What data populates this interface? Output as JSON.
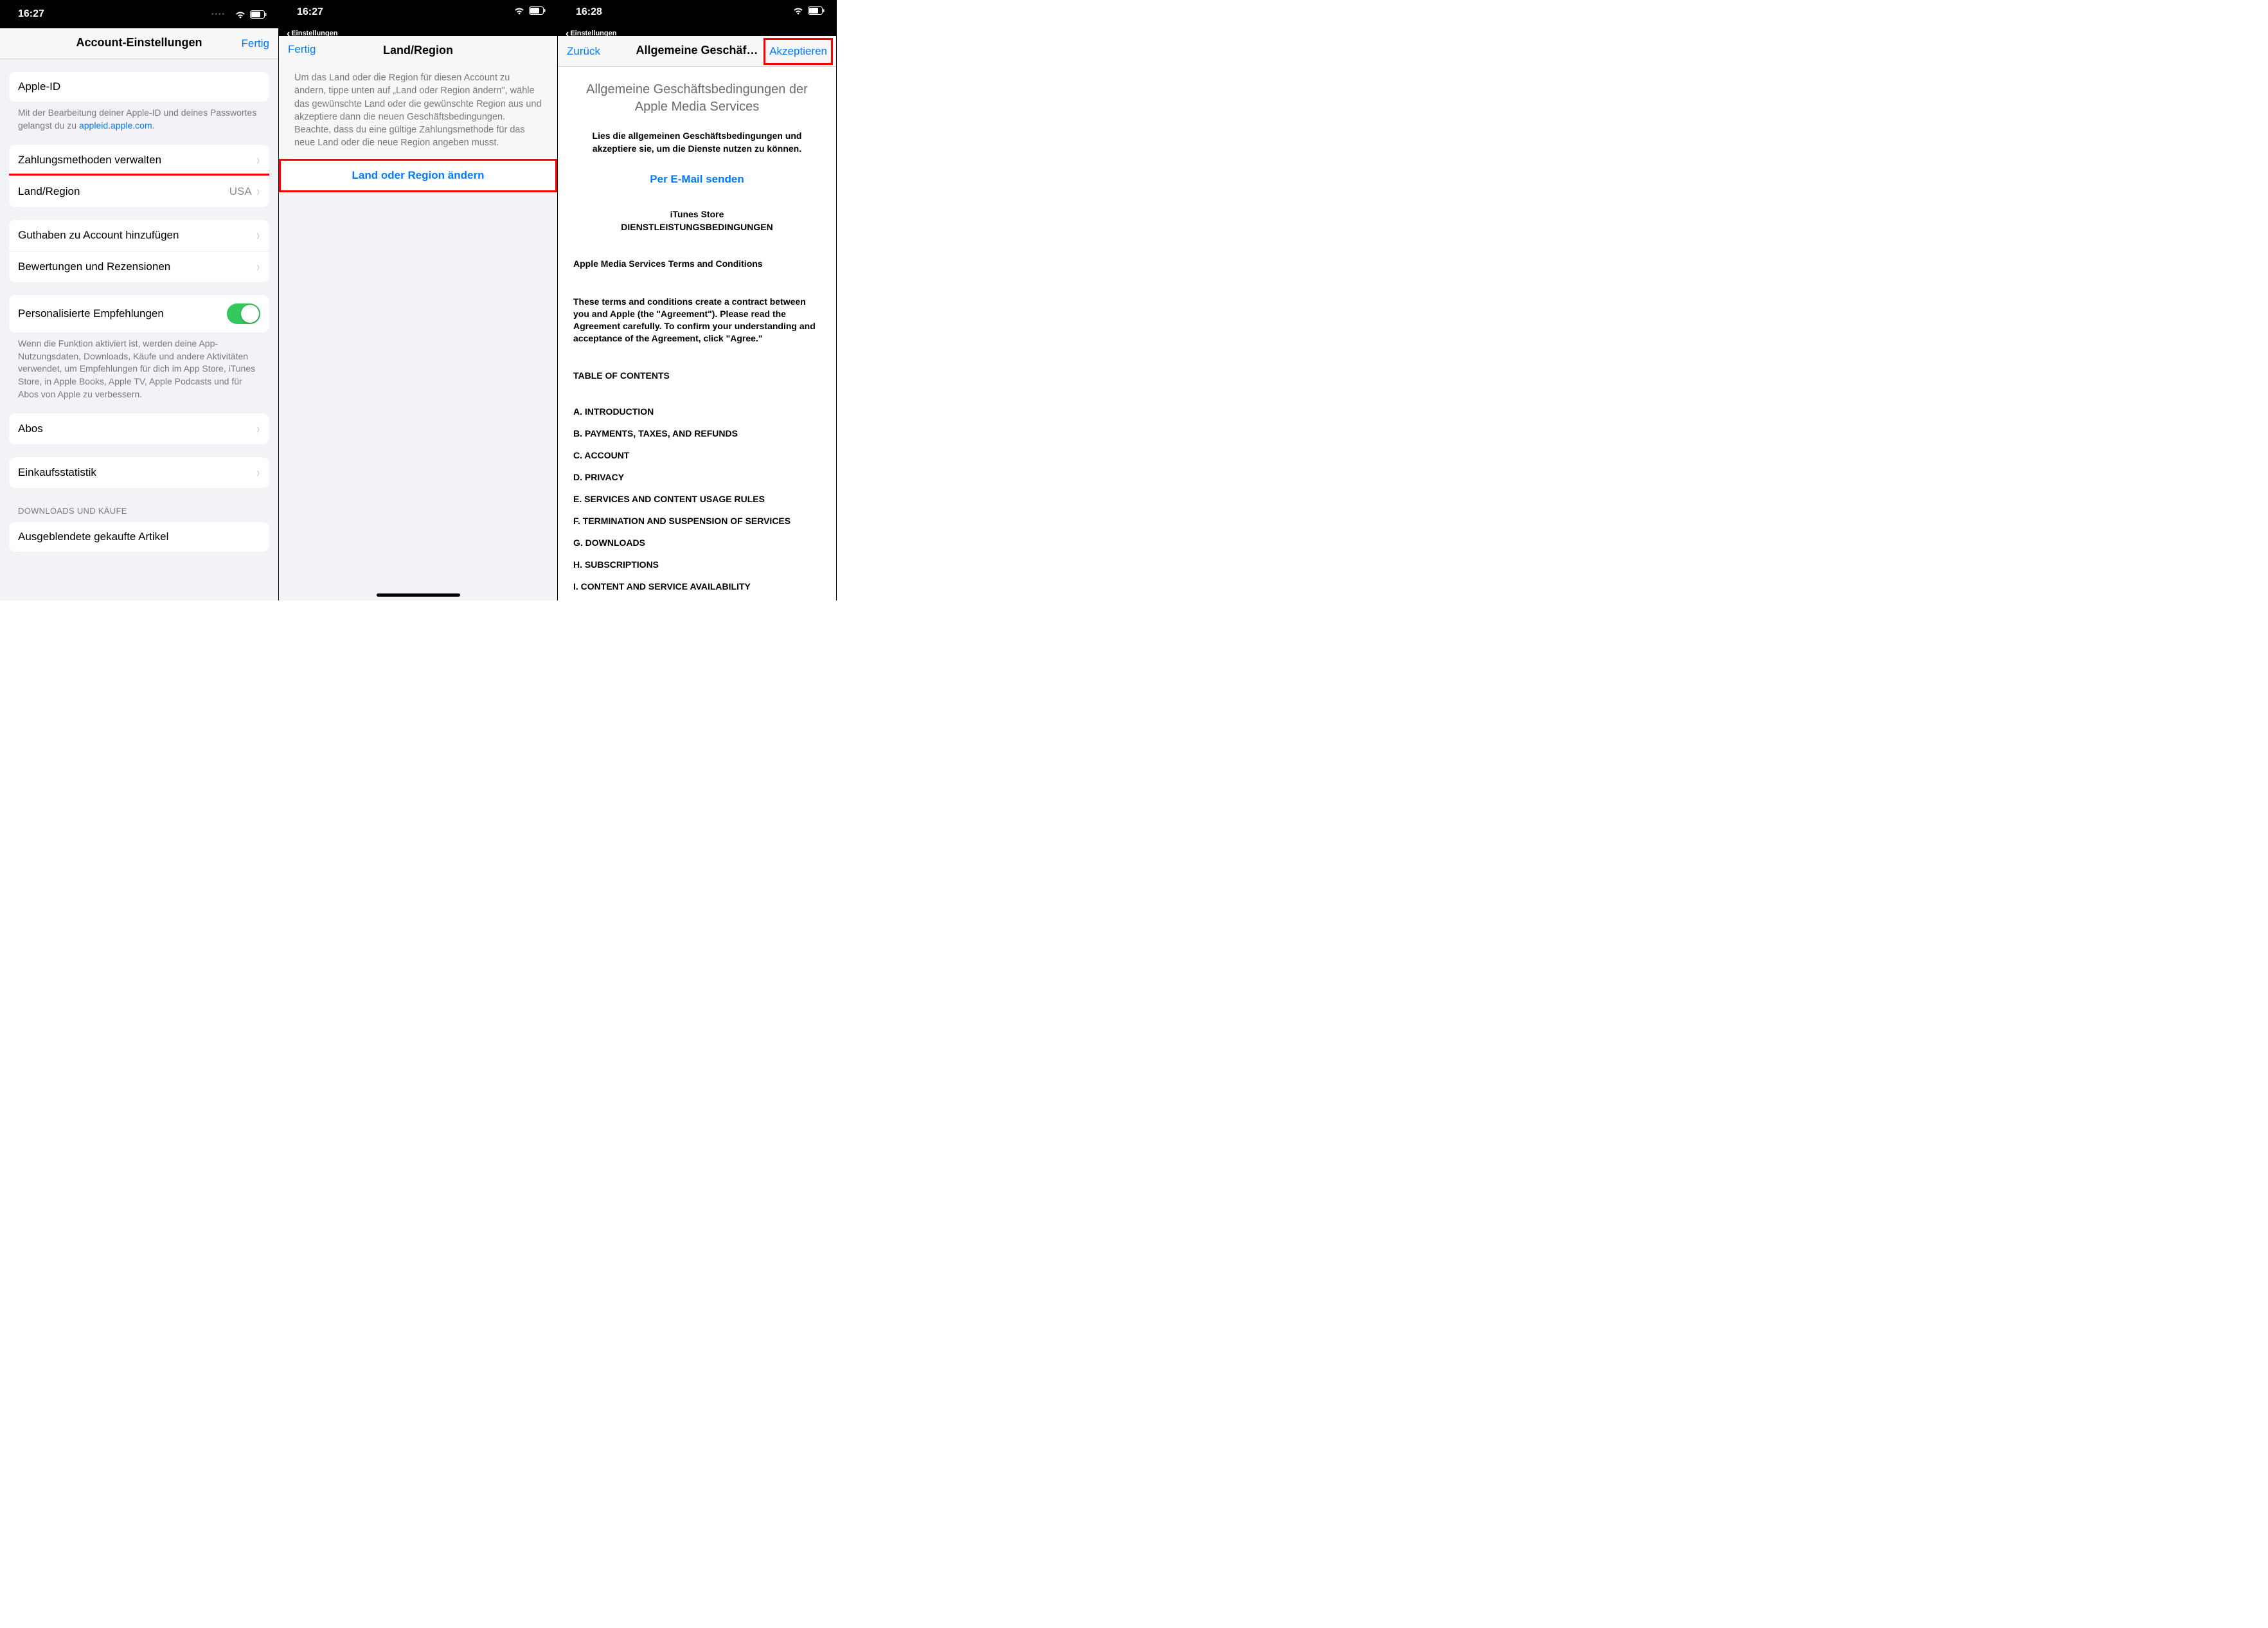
{
  "screen1": {
    "time": "16:27",
    "title": "Account-Einstellungen",
    "done": "Fertig",
    "appleIdLabel": "Apple-ID",
    "appleIdFooterPrefix": "Mit der Bearbeitung deiner Apple-ID und deines Passwortes gelangst du zu ",
    "appleIdFooterLink": "appleid.apple.com",
    "appleIdFooterSuffix": ".",
    "payment": "Zahlungsmethoden verwalten",
    "countryLabel": "Land/Region",
    "countryValue": "USA",
    "addFunds": "Guthaben zu Account hinzufügen",
    "ratings": "Bewertungen und Rezensionen",
    "personalized": "Personalisierte Empfehlungen",
    "personalizedFooter": "Wenn die Funktion aktiviert ist, werden deine App-Nutzungsdaten, Downloads, Käufe und andere Aktivitäten verwendet, um Empfehlungen für dich im App Store, iTunes Store, in Apple Books, Apple TV, Apple Podcasts und für Abos von Apple zu verbessern.",
    "subs": "Abos",
    "purchaseStats": "Einkaufsstatistik",
    "downloadsHeader": "DOWNLOADS UND KÄUFE",
    "hiddenPurchases": "Ausgeblendete gekaufte Artikel"
  },
  "screen2": {
    "time": "16:27",
    "back": "Einstellungen",
    "done": "Fertig",
    "title": "Land/Region",
    "instructions": "Um das Land oder die Region für diesen Account zu ändern, tippe unten auf „Land oder Region ändern\", wähle das gewünschte Land oder die gewünschte Region aus und akzeptiere dann die neuen Geschäftsbedingungen. Beachte, dass du eine gültige Zahlungsmethode für das neue Land oder die neue Region angeben musst.",
    "changeButton": "Land oder Region ändern"
  },
  "screen3": {
    "time": "16:28",
    "backSmall": "Einstellungen",
    "back": "Zurück",
    "title": "Allgemeine Geschäf…",
    "accept": "Akzeptieren",
    "bigTitle": "Allgemeine Geschäftsbedingungen der Apple Media Services",
    "subtitle": "Lies die allgemeinen Geschäftsbedingungen und akzeptiere sie, um die Dienste nutzen zu können.",
    "emailLink": "Per E-Mail senden",
    "h1": "iTunes Store",
    "h2": "DIENSTLEISTUNGSBEDINGUNGEN",
    "para1": "Apple Media Services Terms and Conditions",
    "para2": "These terms and conditions create a contract between you and Apple (the \"Agreement\"). Please read the Agreement carefully. To confirm your understanding and acceptance of the Agreement, click \"Agree.\"",
    "tocHead": "TABLE OF CONTENTS",
    "toc": [
      "A. INTRODUCTION",
      "B. PAYMENTS, TAXES, AND REFUNDS",
      "C. ACCOUNT",
      "D. PRIVACY",
      "E. SERVICES AND CONTENT USAGE RULES",
      "F. TERMINATION AND SUSPENSION OF SERVICES",
      "G. DOWNLOADS",
      "H. SUBSCRIPTIONS",
      "I. CONTENT AND SERVICE AVAILABILITY"
    ]
  }
}
